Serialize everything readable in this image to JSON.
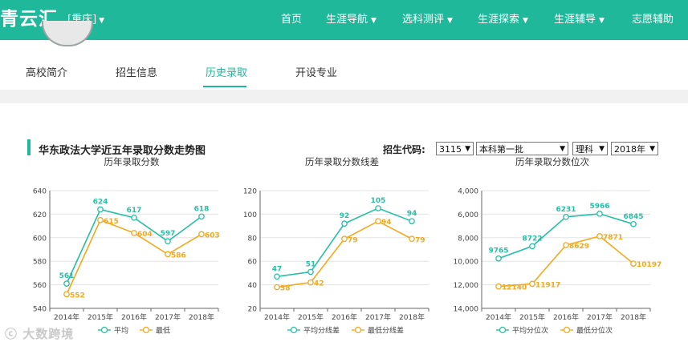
{
  "header": {
    "logo_text": "青云汇",
    "city": "[重庆]",
    "nav": [
      {
        "label": "首页"
      },
      {
        "label": "生涯导航"
      },
      {
        "label": "选科测评"
      },
      {
        "label": "生涯探索"
      },
      {
        "label": "生涯辅导"
      },
      {
        "label": "志愿辅助"
      }
    ]
  },
  "tabs": [
    {
      "label": "高校简介"
    },
    {
      "label": "招生信息"
    },
    {
      "label": "历史录取",
      "active": true
    },
    {
      "label": "开设专业"
    }
  ],
  "section": {
    "title": "华东政法大学近五年录取分数走势图",
    "code_label": "招生代码:",
    "selects": {
      "code": "3115",
      "batch": "本科第一批",
      "subject": "理科",
      "year": "2018年"
    }
  },
  "chart_data": [
    {
      "type": "line",
      "title": "历年录取分数",
      "categories": [
        "2014年",
        "2015年",
        "2016年",
        "2017年",
        "2018年"
      ],
      "series": [
        {
          "name": "平均",
          "color": "#26bfa6",
          "values": [
            561,
            624,
            617,
            597,
            618
          ]
        },
        {
          "name": "最低",
          "color": "#f4a81c",
          "values": [
            552,
            615,
            604,
            586,
            603
          ]
        }
      ],
      "ylim": [
        540,
        640
      ],
      "yticks": [
        "540",
        "560",
        "580",
        "600",
        "620",
        "640"
      ],
      "grid": true,
      "legend": "bottom"
    },
    {
      "type": "line",
      "title": "历年录取分数线差",
      "categories": [
        "2014年",
        "2015年",
        "2016年",
        "2017年",
        "2018年"
      ],
      "series": [
        {
          "name": "平均分线差",
          "color": "#26bfa6",
          "values": [
            47,
            51,
            92,
            105,
            94
          ]
        },
        {
          "name": "最低分线差",
          "color": "#f4a81c",
          "values": [
            38,
            42,
            79,
            94,
            79
          ]
        }
      ],
      "ylim": [
        20,
        120
      ],
      "yticks": [
        "20",
        "40",
        "60",
        "80",
        "100",
        "120"
      ],
      "grid": true,
      "legend": "bottom"
    },
    {
      "type": "line",
      "title": "历年录取分数位次",
      "categories": [
        "2014年",
        "2015年",
        "2016年",
        "2017年",
        "2018年"
      ],
      "series": [
        {
          "name": "平均分位次",
          "color": "#26bfa6",
          "values": [
            9765,
            8722,
            6231,
            5966,
            6845
          ]
        },
        {
          "name": "最低分位次",
          "color": "#f4a81c",
          "values": [
            12140,
            11917,
            8629,
            7871,
            10197
          ]
        }
      ],
      "ylim": [
        4000,
        14000
      ],
      "inverted_y": true,
      "yticks": [
        "4,000",
        "6,000",
        "8,000",
        "10,000",
        "12,000",
        "14,000"
      ],
      "grid": true,
      "legend": "bottom"
    }
  ],
  "watermark": "大数跨境"
}
